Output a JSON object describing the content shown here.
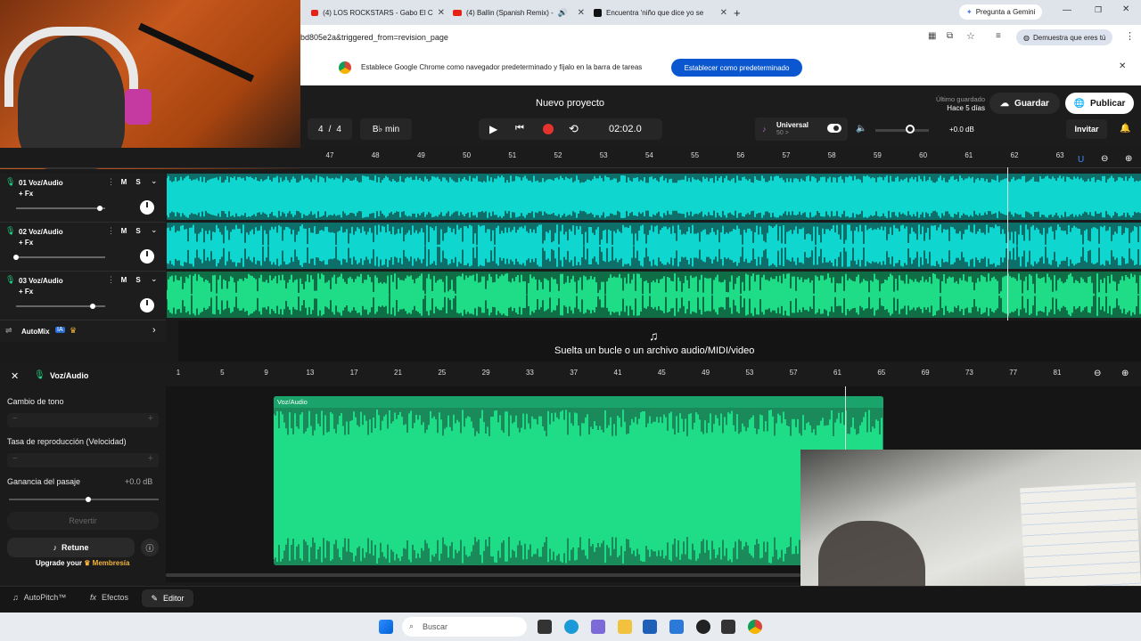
{
  "browser": {
    "tabs": [
      {
        "label": "(4) LOS ROCKSTARS - Gabo El C"
      },
      {
        "label": "(4) Ballin (Spanish Remix) -"
      },
      {
        "label": "Encuentra 'niño que dice yo se"
      }
    ],
    "gemini_label": "Pregunta a Gemini",
    "url": "bd805e2a&triggered_from=revision_page",
    "profile_label": "Demuestra que eres tú",
    "banner_text": "Establece Google Chrome como navegador predeterminado y fíjalo en la barra de tareas",
    "banner_button": "Establecer como predeterminado"
  },
  "app": {
    "project_title": "Nuevo proyecto",
    "last_saved_label": "Último guardado",
    "last_saved_value": "Hace 5 días",
    "save_label": "Guardar",
    "publish_label": "Publicar",
    "time_signature_a": "4",
    "time_signature_sep": "/",
    "time_signature_b": "4",
    "key": "B♭ min",
    "time": "02:02.0",
    "instrument_name": "Universal",
    "instrument_sub": "50 >",
    "volume_db": "+0.0 dB",
    "invite_label": "Invitar",
    "colors": {
      "accent_cyan": "#10d6d0",
      "accent_green": "#1fdc86",
      "record_red": "#e5322d"
    }
  },
  "timeline_top": {
    "ticks": [
      "47",
      "48",
      "49",
      "50",
      "51",
      "52",
      "53",
      "54",
      "55",
      "56",
      "57",
      "58",
      "59",
      "60",
      "61",
      "62",
      "63"
    ]
  },
  "tracks": [
    {
      "name": "01  Voz/Audio",
      "fx": "+ Fx",
      "mute": "M",
      "solo": "S",
      "volume": 0.94
    },
    {
      "name": "02  Voz/Audio",
      "fx": "+ Fx",
      "mute": "M",
      "solo": "S",
      "volume": 0.0
    },
    {
      "name": "03  Voz/Audio",
      "fx": "+ Fx",
      "mute": "M",
      "solo": "S",
      "volume": 0.86
    }
  ],
  "automix": {
    "label": "AutoMix",
    "badge": "IA"
  },
  "drop_hint": "Suelta un bucle o un archivo audio/MIDI/video",
  "editor": {
    "track_label": "Voz/Audio",
    "pitch_label": "Cambio de tono",
    "rate_label": "Tasa de reproducción (Velocidad)",
    "gain_label": "Ganancia del pasaje",
    "gain_value": "+0.0 dB",
    "gain_level": 0.53,
    "revert_label": "Revertir",
    "retune_label": "Retune",
    "upgrade_prefix": "Upgrade your",
    "upgrade_link": "Membresía",
    "clip_label": "Voz/Audio",
    "ticks": [
      "1",
      "5",
      "9",
      "13",
      "17",
      "21",
      "25",
      "29",
      "33",
      "37",
      "41",
      "45",
      "49",
      "53",
      "57",
      "61",
      "65",
      "69",
      "73",
      "77",
      "81"
    ]
  },
  "bottom_tabs": {
    "autopitch": "AutoPitch™",
    "effects": "Efectos",
    "editor": "Editor"
  },
  "taskbar": {
    "search_placeholder": "Buscar"
  }
}
